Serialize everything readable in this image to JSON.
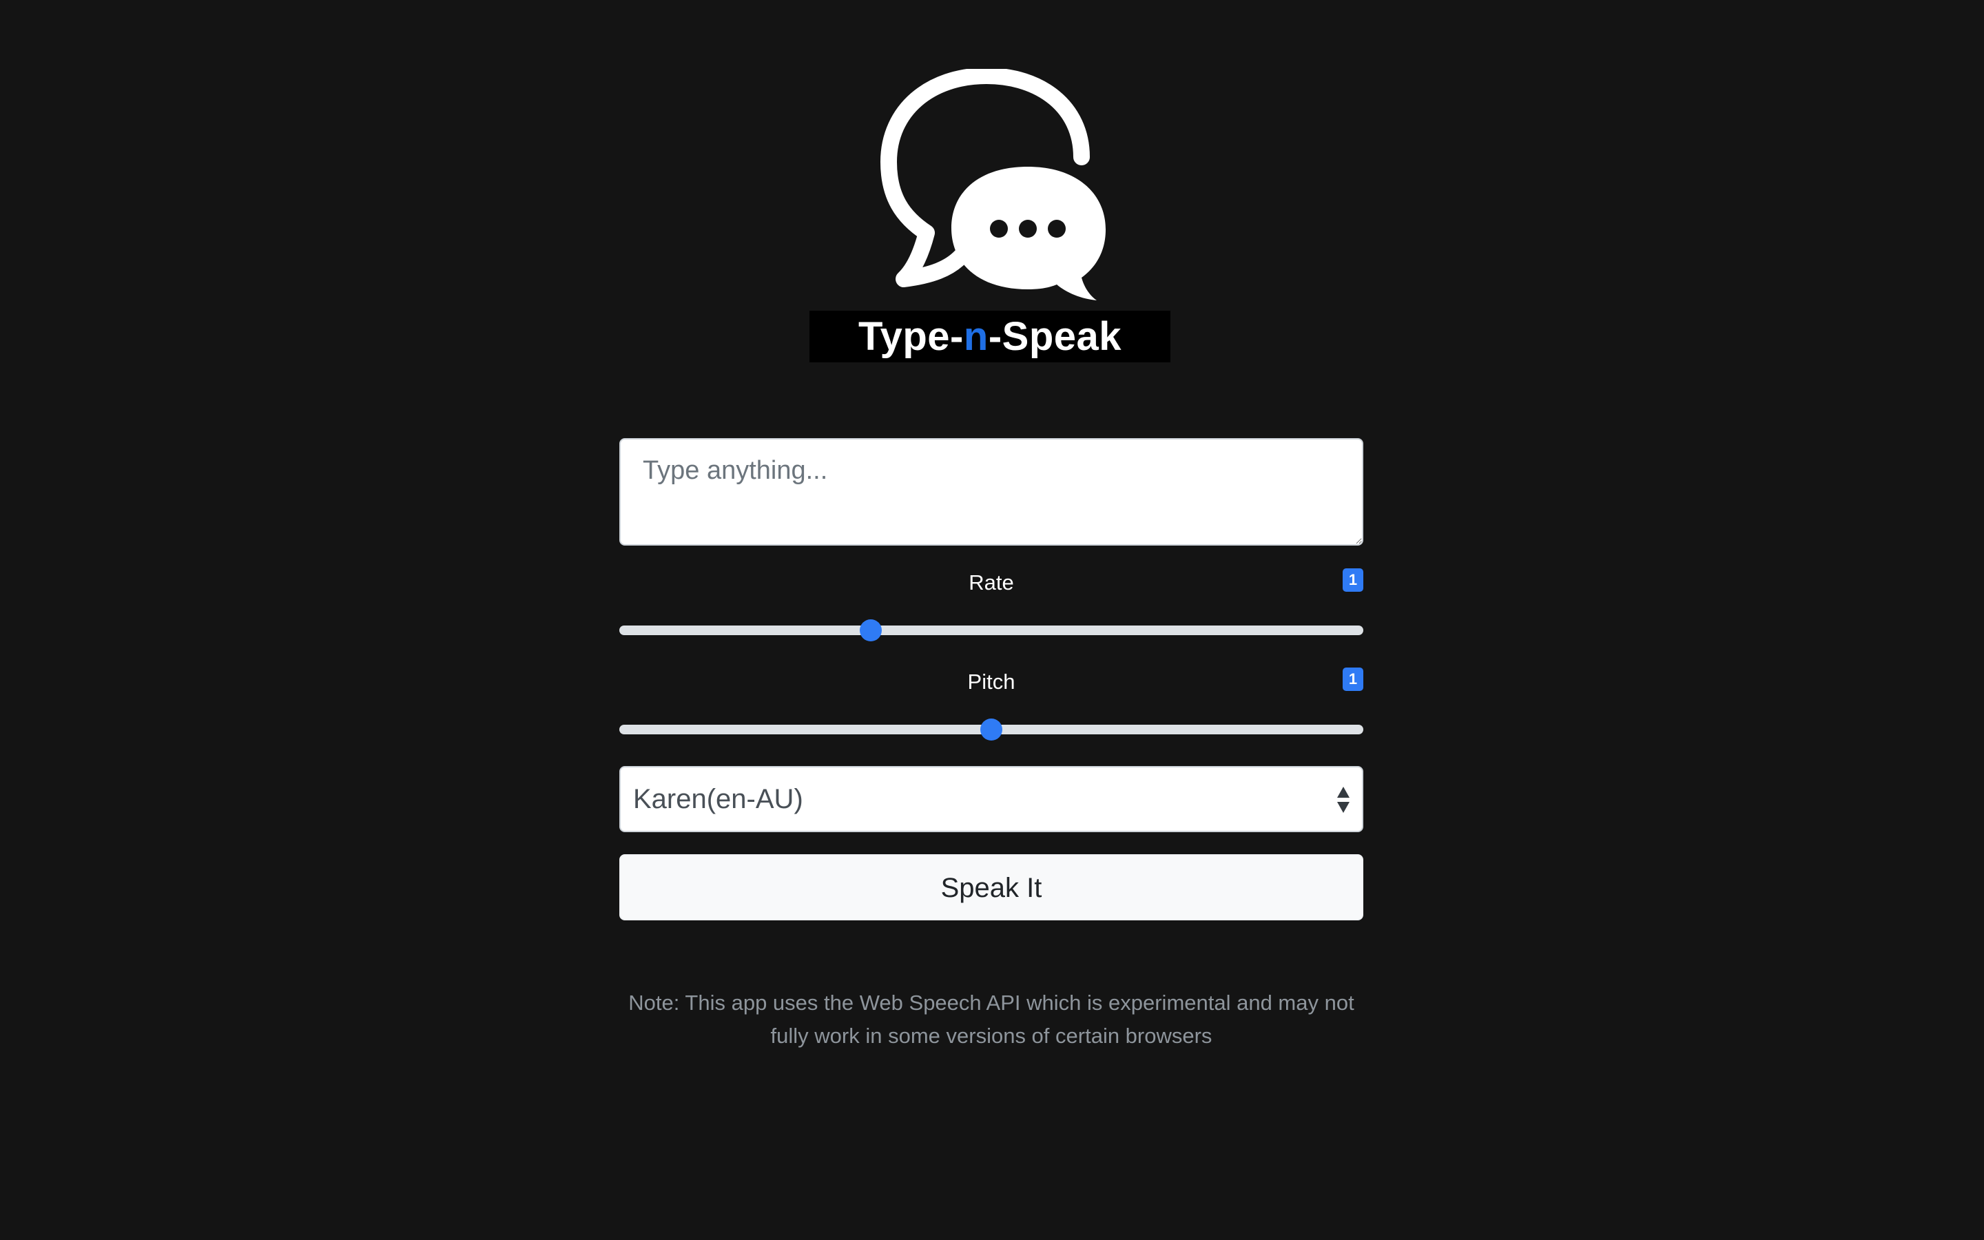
{
  "logo": {
    "icon": "speech-bubbles-icon",
    "title_part1": "Type-",
    "title_accent": "n",
    "title_part2": "-Speak",
    "accent_color": "#1f6fe5"
  },
  "text_input": {
    "placeholder": "Type anything...",
    "value": ""
  },
  "rate": {
    "label": "Rate",
    "badge": "1",
    "value": 1,
    "min": 0.5,
    "max": 2
  },
  "pitch": {
    "label": "Pitch",
    "badge": "1",
    "value": 1,
    "min": 0,
    "max": 2
  },
  "voice_select": {
    "selected": "Karen(en-AU)",
    "icon": "select-arrows-icon"
  },
  "speak_button": {
    "label": "Speak It"
  },
  "note": {
    "line1": "Note: This app uses the Web Speech API which is experimental and may not",
    "line2": "fully work in some versions of certain browsers"
  },
  "colors": {
    "background": "#141414",
    "accent": "#2f7bf5"
  }
}
